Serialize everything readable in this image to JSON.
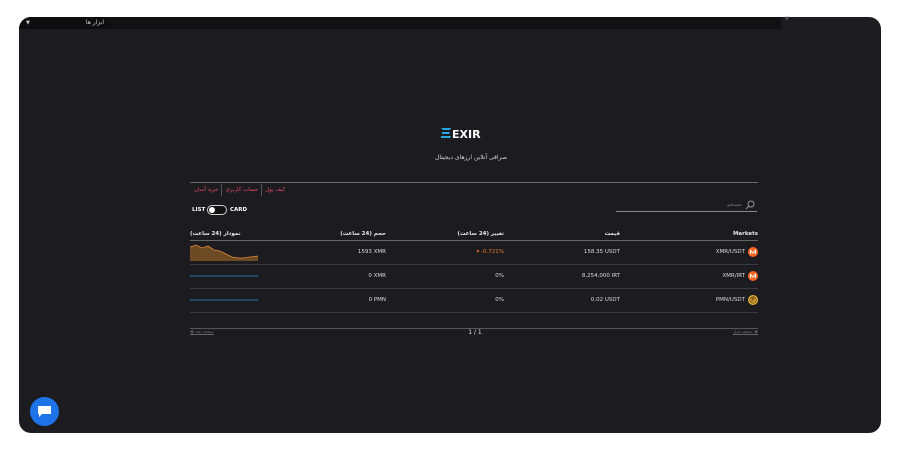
{
  "topbar": {
    "tools_label": "ابزار ها"
  },
  "brand": {
    "logo_text": "EXIR",
    "tagline": "صرافی آنلاین ارزهای دیجیتال"
  },
  "nav": {
    "items": [
      "خرید آسان",
      "حساب کاربری",
      "کیف پول"
    ]
  },
  "view_toggle": {
    "left_label": "LIST",
    "right_label": "CARD",
    "selected": "LIST"
  },
  "search": {
    "placeholder": "جستجو"
  },
  "table": {
    "headers": {
      "chart": "نمودار (24 ساعت)",
      "volume": "حجم (24 ساعت)",
      "change": "تغییر (24 ساعت)",
      "price": "قیمت",
      "market": "Markets"
    },
    "rows": [
      {
        "chart": "up-down",
        "volume": "1593 XMR",
        "change": "-0.721%",
        "price": "158.35 USDT",
        "market": "XMR/USDT",
        "icon": "monero-icon"
      },
      {
        "chart": "flat",
        "volume": "0 XMR",
        "change": "0%",
        "price": "8,254,000 IRT",
        "market": "XMR/IRT",
        "icon": "monero-icon"
      },
      {
        "chart": "flat",
        "volume": "0 PMN",
        "change": "0%",
        "price": "0.02 USDT",
        "market": "PMN/USDT",
        "icon": "pmn-icon"
      }
    ]
  },
  "pagination": {
    "prev_label": "صفحه قبل",
    "next_label": "صفحه بعد",
    "page": "1 / 1"
  },
  "colors": {
    "background": "#1c1c20",
    "accent_nav": "#e8486b",
    "negative": "#f07a2b",
    "spark_line": "#2b8fd6",
    "chat": "#1e73e8"
  }
}
